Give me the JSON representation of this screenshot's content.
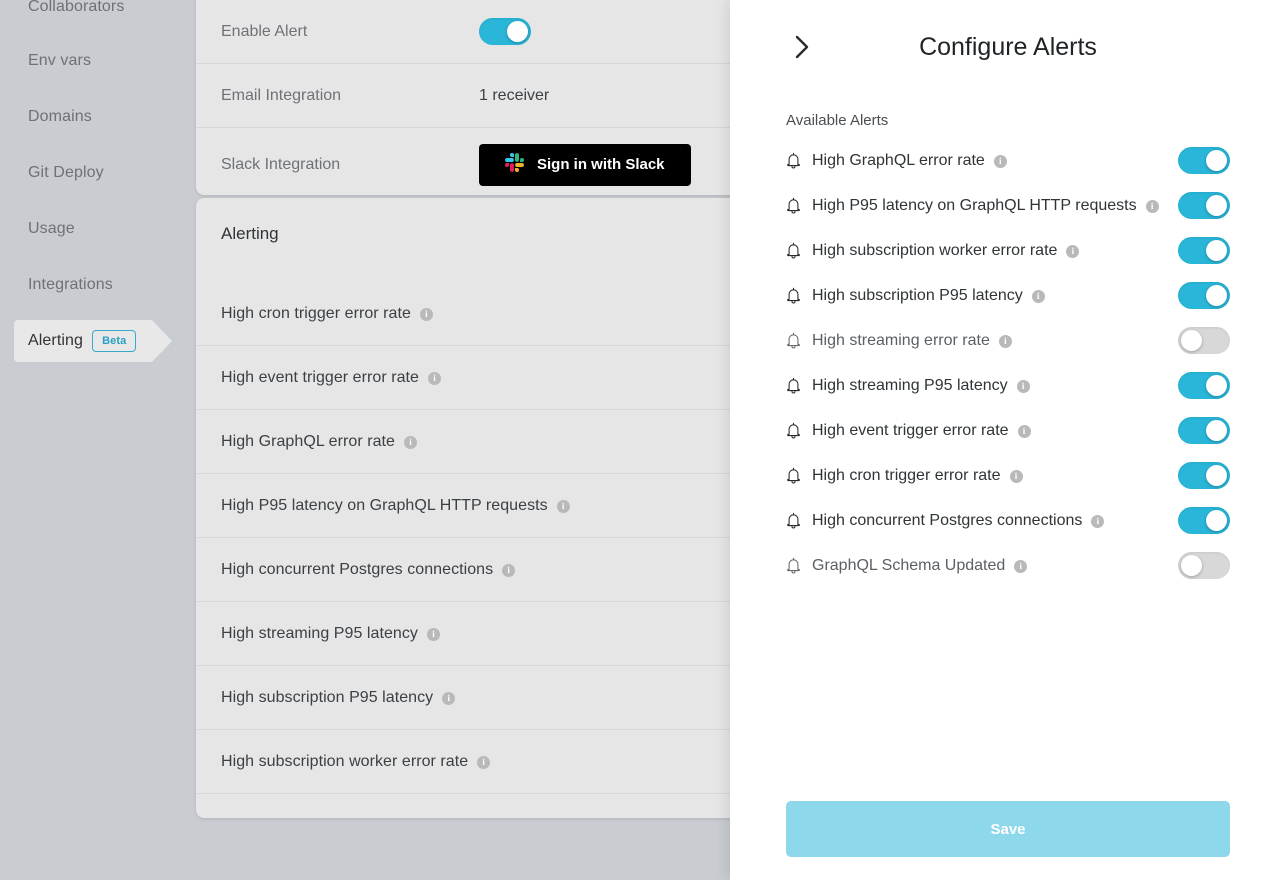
{
  "sidebar": {
    "items": [
      {
        "label": "Collaborators",
        "active": false
      },
      {
        "label": "Env vars",
        "active": false
      },
      {
        "label": "Domains",
        "active": false
      },
      {
        "label": "Git Deploy",
        "active": false
      },
      {
        "label": "Usage",
        "active": false
      },
      {
        "label": "Integrations",
        "active": false
      },
      {
        "label": "Alerting",
        "active": true,
        "badge": "Beta"
      }
    ]
  },
  "integration_card": {
    "rows": [
      {
        "label": "Enable Alert",
        "type": "toggle",
        "value": "on"
      },
      {
        "label": "Email Integration",
        "type": "text",
        "value": "1 receiver"
      },
      {
        "label": "Slack Integration",
        "type": "button",
        "value": "Sign in with Slack"
      }
    ]
  },
  "alerting_card": {
    "title": "Alerting",
    "rows": [
      {
        "label": "High cron trigger error rate"
      },
      {
        "label": "High event trigger error rate"
      },
      {
        "label": "High GraphQL error rate"
      },
      {
        "label": "High P95 latency on GraphQL HTTP requests"
      },
      {
        "label": "High concurrent Postgres connections"
      },
      {
        "label": "High streaming P95 latency"
      },
      {
        "label": "High subscription P95 latency"
      },
      {
        "label": "High subscription worker error rate"
      }
    ]
  },
  "panel": {
    "title": "Configure Alerts",
    "back_icon": "chevron-right-icon",
    "section_label": "Available Alerts",
    "save_label": "Save",
    "alerts": [
      {
        "label": "High GraphQL error rate",
        "enabled": true
      },
      {
        "label": "High P95 latency on GraphQL HTTP requests",
        "enabled": true
      },
      {
        "label": "High subscription worker error rate",
        "enabled": true
      },
      {
        "label": "High subscription P95 latency",
        "enabled": true
      },
      {
        "label": "High streaming error rate",
        "enabled": false
      },
      {
        "label": "High streaming P95 latency",
        "enabled": true
      },
      {
        "label": "High event trigger error rate",
        "enabled": true
      },
      {
        "label": "High cron trigger error rate",
        "enabled": true
      },
      {
        "label": "High concurrent Postgres connections",
        "enabled": true
      },
      {
        "label": "GraphQL Schema Updated",
        "enabled": false
      }
    ]
  },
  "colors": {
    "accent": "#29b6d8",
    "accent_disabled": "#8dd8ea",
    "page_bg": "#c9ccd1",
    "card_bg": "#e6e6e6",
    "panel_bg": "#ffffff",
    "toggle_off": "#d8d8d8"
  }
}
